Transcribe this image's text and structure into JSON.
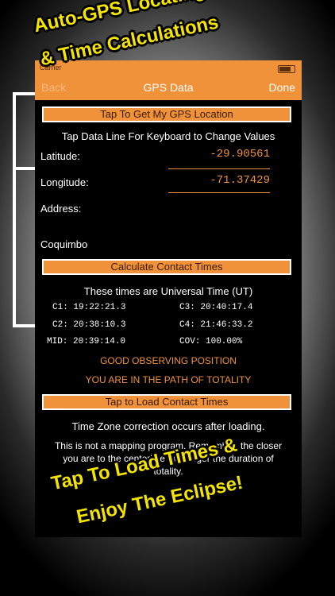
{
  "status": {
    "carrier": "Carrier"
  },
  "navbar": {
    "title": "GPS Data",
    "done_label": "Done",
    "back_label": "Back"
  },
  "gps_button": "Tap To Get My GPS Location",
  "instruction": "Tap Data Line For Keyboard to Change Values",
  "location": {
    "latitude_label": "Latitude:",
    "latitude_value": "-29.90561",
    "longitude_label": "Longitude:",
    "longitude_value": "-71.37429",
    "address_label": "Address:",
    "address_value": "Coquimbo"
  },
  "calc_button": "Calculate Contact Times",
  "times_note": "These times are Universal Time (UT)",
  "contacts": {
    "c1": "C1: 19:22:21.3",
    "c2": "C2: 20:38:10.3",
    "mid": "MID: 20:39:14.0",
    "c3": "C3: 20:40:17.4",
    "c4": "C4: 21:46:33.2",
    "cov": "COV: 100.00%"
  },
  "status_messages": {
    "position": "GOOD OBSERVING POSITION",
    "path": "YOU ARE IN THE PATH OF TOTALITY"
  },
  "load_button": "Tap to Load Contact Times",
  "timezone_note": "Time Zone correction occurs after loading.",
  "mapping_note": "This is not a mapping program. Remember, the closer you are to the centerline the longer the duration of totality.",
  "banners": {
    "top_line1": "Auto-GPS Locating",
    "top_line2": "& Time Calculations",
    "bottom_line1": "Tap To Load Times &",
    "bottom_line2": "Enjoy The Eclipse!"
  },
  "colors": {
    "accent": "#f0923a",
    "banner": "#f5e400",
    "background": "#000000"
  }
}
